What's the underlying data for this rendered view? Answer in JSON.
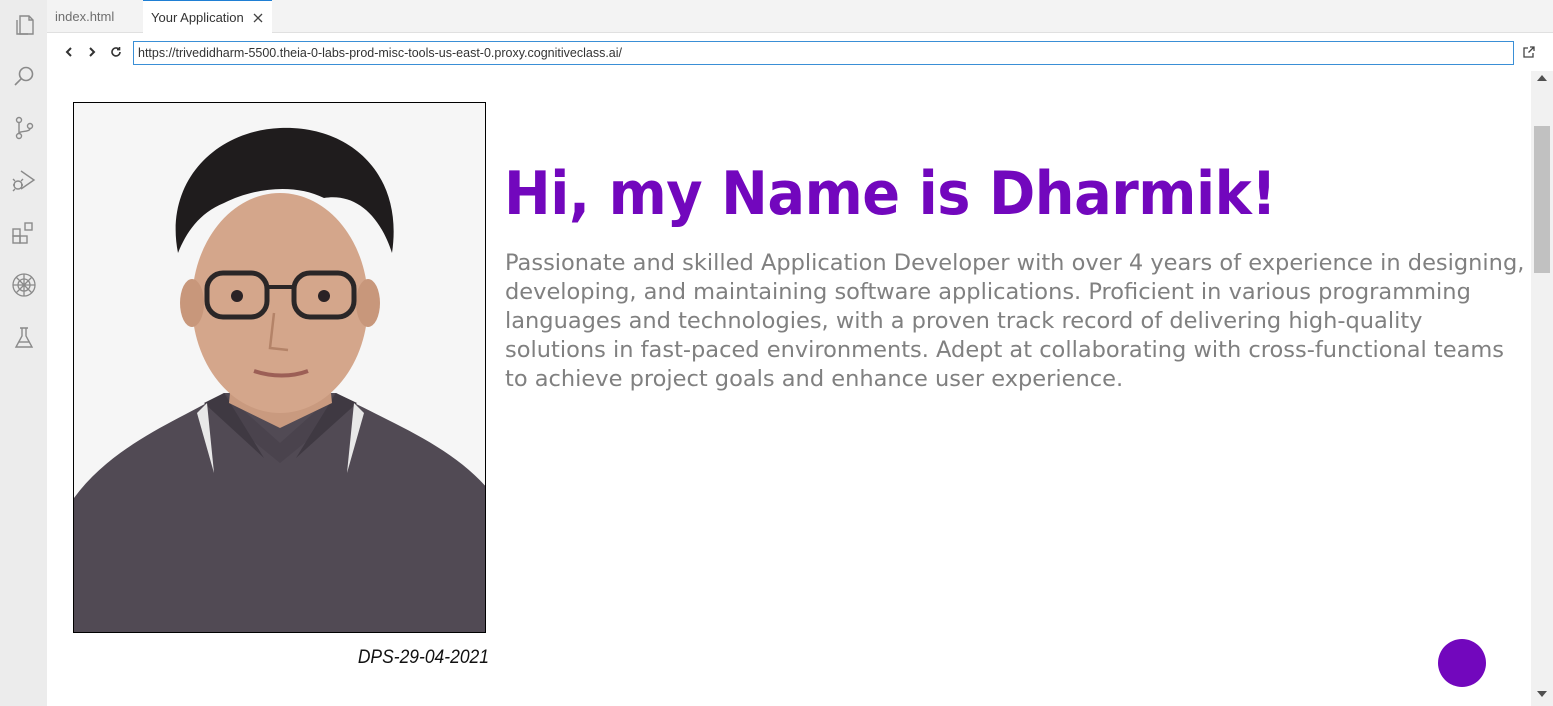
{
  "tabs": [
    {
      "label": "index.html",
      "active": false
    },
    {
      "label": "Your Application",
      "active": true
    }
  ],
  "tab_close_icon": "close-icon",
  "browser": {
    "url": "https://trivedidharm-5500.theia-0-labs-prod-misc-tools-us-east-0.proxy.cognitiveclass.ai/",
    "back_icon": "chevron-left-icon",
    "forward_icon": "chevron-right-icon",
    "reload_icon": "reload-icon",
    "external_icon": "open-external-icon"
  },
  "activity_bar": [
    "files-icon",
    "search-icon",
    "source-control-icon",
    "run-debug-icon",
    "extensions-icon",
    "skills-network-icon",
    "lab-flask-icon"
  ],
  "page": {
    "photo_caption": "DPS-29-04-2021",
    "heading": "Hi, my Name is Dharmik!",
    "bio": "Passionate and skilled Application Developer with over 4 years of experience in designing, developing, and maintaining software applications. Proficient in various programming languages and technologies, with a proven track record of delivering high-quality solutions in fast-paced environments. Adept at collaborating with cross-functional teams to achieve project goals and enhance user experience."
  },
  "colors": {
    "accent": "#7207bd",
    "bio_text": "#808080",
    "activity_bar": "#ececec",
    "tab_active_border": "#1f7fd4"
  }
}
